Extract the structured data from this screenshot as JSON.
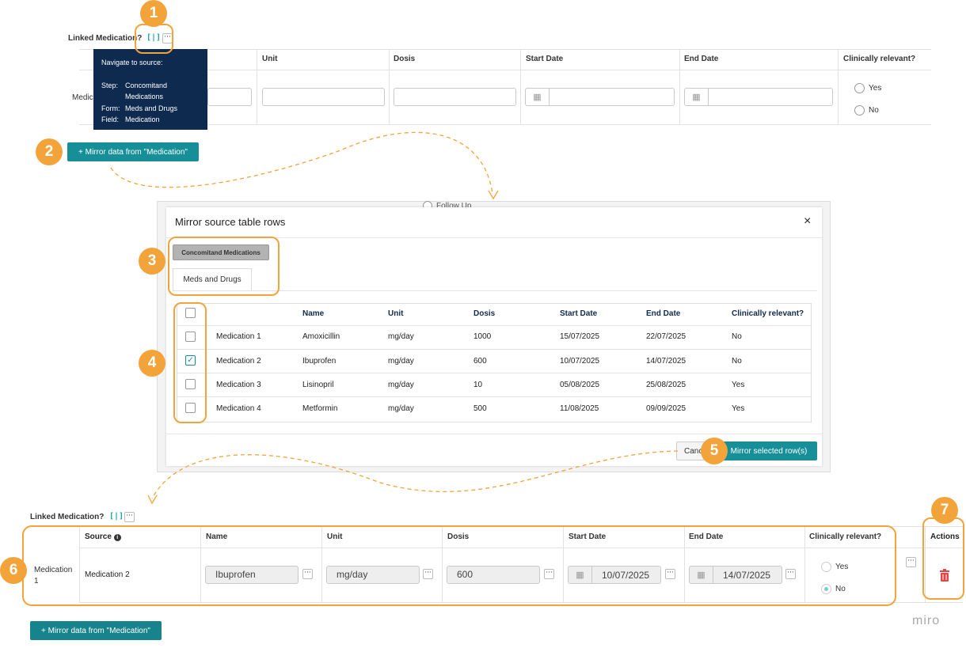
{
  "top": {
    "label": "Linked Medication?",
    "columns": [
      "Unit",
      "Dosis",
      "Start Date",
      "End Date",
      "Clinically relevant?"
    ],
    "row_label_partial": "Medica",
    "radio_yes": "Yes",
    "radio_no": "No",
    "mirror_button": "+ Mirror data from \"Medication\""
  },
  "tooltip": {
    "title": "Navigate to source:",
    "step_label": "Step:",
    "step_value": "Concomitand Medications",
    "form_label": "Form:",
    "form_value": "Meds and Drugs",
    "field_label": "Field:",
    "field_value": "Medication"
  },
  "background_partial": {
    "follow_up": "Follow Up"
  },
  "modal": {
    "title": "Mirror source table rows",
    "close": "×",
    "step_tab": "Concomitand Medications",
    "form_tab": "Meds and Drugs",
    "columns": [
      "Name",
      "Unit",
      "Dosis",
      "Start Date",
      "End Date",
      "Clinically relevant?"
    ],
    "rows": [
      {
        "source": "Medication 1",
        "name": "Amoxicillin",
        "unit": "mg/day",
        "dosis": "1000",
        "start": "15/07/2025",
        "end": "22/07/2025",
        "relevant": "No",
        "checked": false
      },
      {
        "source": "Medication 2",
        "name": "Ibuprofen",
        "unit": "mg/day",
        "dosis": "600",
        "start": "10/07/2025",
        "end": "14/07/2025",
        "relevant": "No",
        "checked": true
      },
      {
        "source": "Medication 3",
        "name": "Lisinopril",
        "unit": "mg/day",
        "dosis": "10",
        "start": "05/08/2025",
        "end": "25/08/2025",
        "relevant": "Yes",
        "checked": false
      },
      {
        "source": "Medication 4",
        "name": "Metformin",
        "unit": "mg/day",
        "dosis": "500",
        "start": "11/08/2025",
        "end": "09/09/2025",
        "relevant": "Yes",
        "checked": false
      }
    ],
    "cancel_partial": "Canc",
    "mirror_selected": "Mirror selected row(s)"
  },
  "bottom": {
    "label": "Linked Medication?",
    "columns": [
      "Source",
      "Name",
      "Unit",
      "Dosis",
      "Start Date",
      "End Date",
      "Clinically relevant?",
      "Actions"
    ],
    "row_label": "Medication 1",
    "source": "Medication 2",
    "name": "Ibuprofen",
    "unit": "mg/day",
    "dosis": "600",
    "start": "10/07/2025",
    "end": "14/07/2025",
    "radio_yes": "Yes",
    "radio_no": "No",
    "relevant_selected": "No",
    "mirror_button": "+ Mirror data from \"Medication\""
  },
  "badges": [
    "1",
    "2",
    "3",
    "4",
    "5",
    "6",
    "7"
  ],
  "watermark": "miro",
  "colors": {
    "accent": "#f2a33a",
    "teal": "#178f99",
    "navy": "#0f2a4f",
    "delete": "#e04848"
  }
}
